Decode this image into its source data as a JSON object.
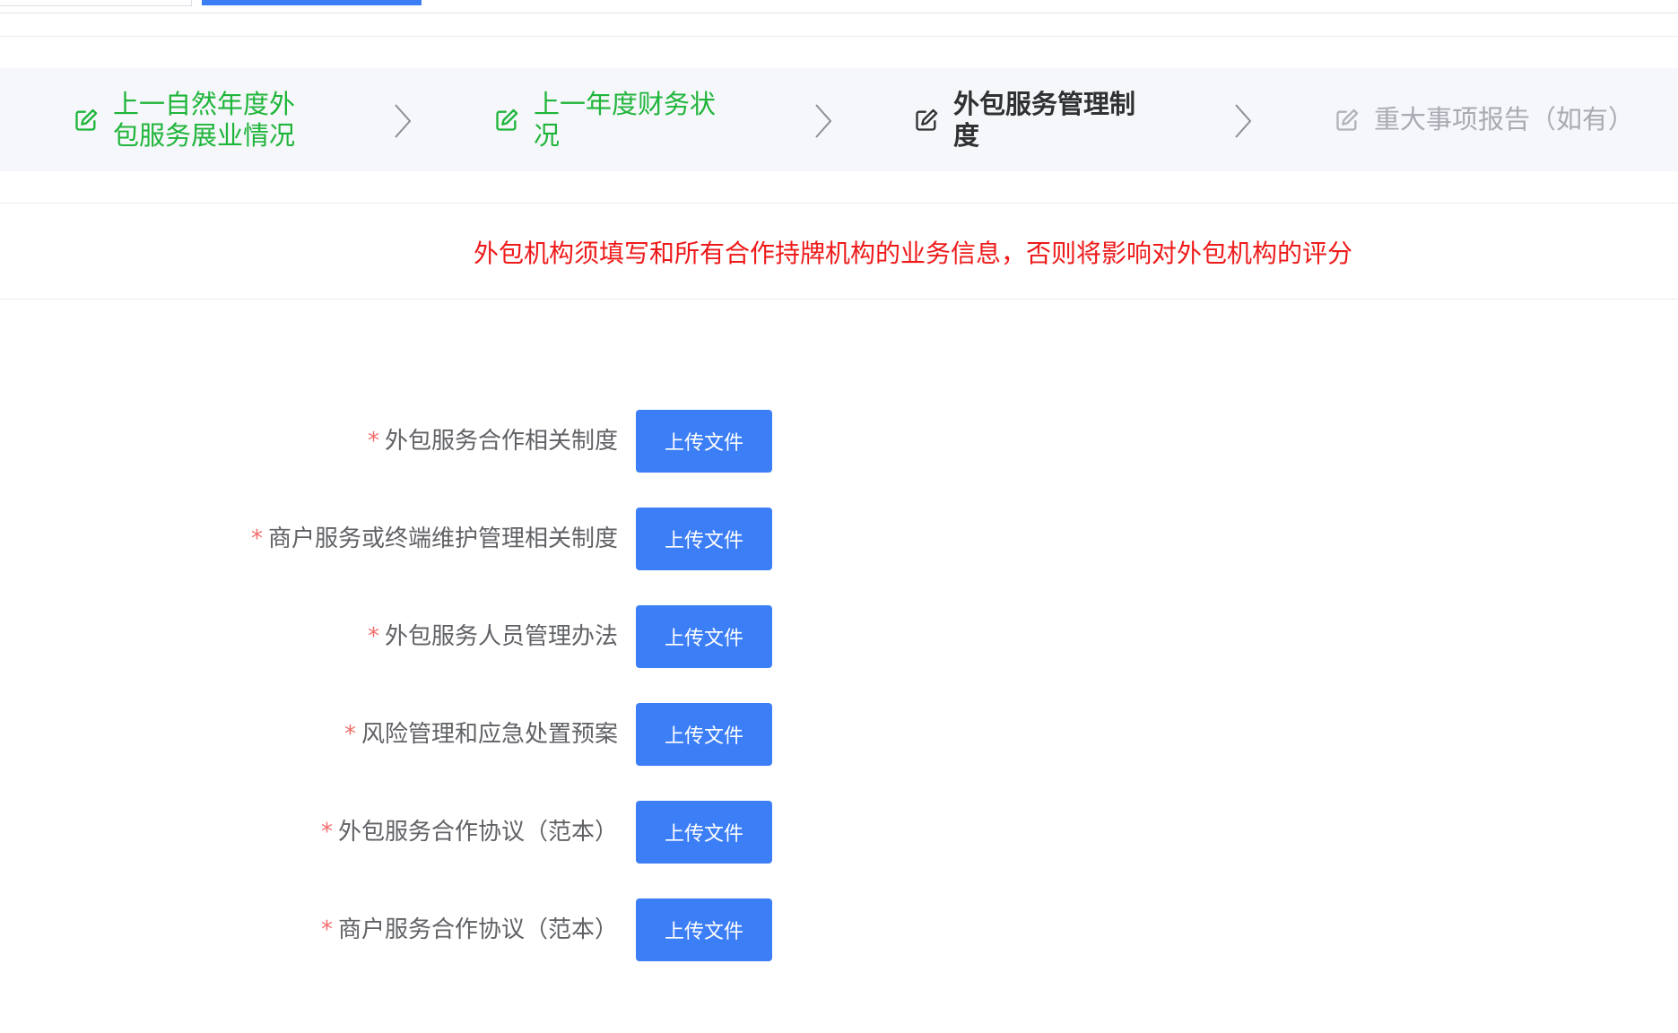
{
  "steps": [
    {
      "line1": "上一自然年度外",
      "line2": "包服务展业情况",
      "status": "done",
      "icon": "edit-icon"
    },
    {
      "line1": "上一年度财务状",
      "line2": "况",
      "status": "done",
      "icon": "edit-icon"
    },
    {
      "line1": "外包服务管理制",
      "line2": "度",
      "status": "active",
      "icon": "edit-icon"
    },
    {
      "line1": "重大事项报告（如有）",
      "status": "todo",
      "icon": "edit-icon"
    }
  ],
  "notice": "外包机构须填写和所有合作持牌机构的业务信息，否则将影响对外包机构的评分",
  "form": {
    "required_mark": "*",
    "upload_label": "上传文件",
    "fields": [
      {
        "label": "外包服务合作相关制度"
      },
      {
        "label": "商户服务或终端维护管理相关制度"
      },
      {
        "label": "外包服务人员管理办法"
      },
      {
        "label": "风险管理和应急处置预案"
      },
      {
        "label": "外包服务合作协议（范本）"
      },
      {
        "label": "商户服务合作协议（范本）"
      }
    ]
  },
  "colors": {
    "primary": "#3c7ef6",
    "done": "#1fb53a",
    "notice": "#ee1a1a",
    "required": "#f56c6c"
  }
}
